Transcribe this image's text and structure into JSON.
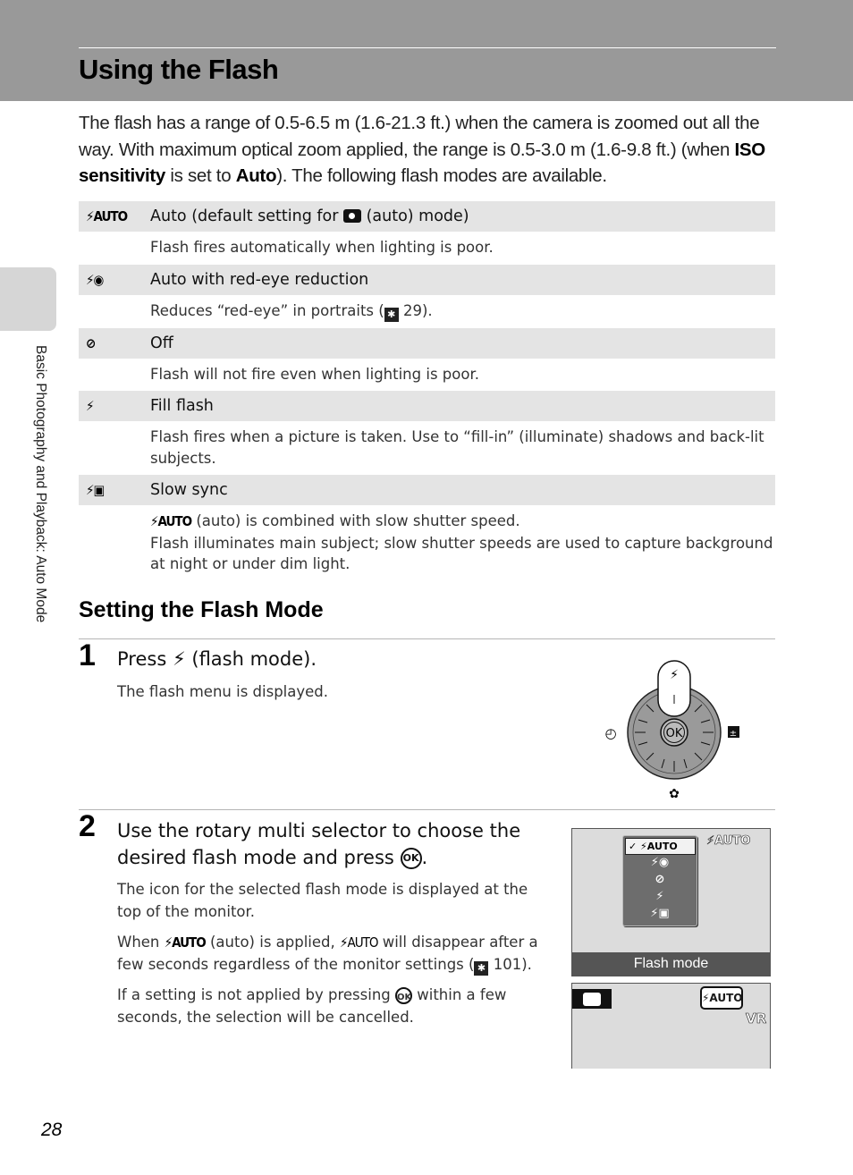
{
  "header": {
    "title": "Using the Flash"
  },
  "intro": {
    "part1": "The flash has a range of 0.5-6.5 m (1.6-21.3 ft.) when the camera is zoomed out all the way. With maximum optical zoom applied, the range is 0.5-3.0 m (1.6-9.8 ft.) (when ",
    "bold1": "ISO sensitivity",
    "part2": " is set to ",
    "bold2": "Auto",
    "part3": "). The following flash modes are available."
  },
  "side_tab": {
    "label": "Basic Photography and Playback: Auto Mode"
  },
  "flash_modes": [
    {
      "icon": "flash-auto-icon",
      "icon_text": "⚡AUTO",
      "title_pre": "Auto (default setting for ",
      "title_post": " (auto) mode)",
      "desc": "Flash fires automatically when lighting is poor."
    },
    {
      "icon": "red-eye-icon",
      "icon_text": "⚡◉",
      "title": "Auto with red-eye reduction",
      "desc_pre": "Reduces “red-eye” in portraits (",
      "desc_ref": "29",
      "desc_post": ")."
    },
    {
      "icon": "flash-off-icon",
      "icon_text": "⊘",
      "title": "Off",
      "desc": "Flash will not fire even when lighting is poor."
    },
    {
      "icon": "fill-flash-icon",
      "icon_text": "⚡",
      "title": "Fill flash",
      "desc": "Flash fires when a picture is taken. Use to “fill-in” (illuminate) shadows and back-lit subjects."
    },
    {
      "icon": "slow-sync-icon",
      "icon_text": "⚡▣",
      "title": "Slow sync",
      "desc_line1_icon": "⚡AUTO",
      "desc_line1": " (auto) is combined with slow shutter speed.",
      "desc_line2": "Flash illuminates main subject; slow shutter speeds are used to capture background at night or under dim light."
    }
  ],
  "section": {
    "title": "Setting the Flash Mode"
  },
  "steps": [
    {
      "number": "1",
      "title_pre": "Press ",
      "title_icon": "⚡",
      "title_post": " (flash mode).",
      "body": "The flash menu is displayed."
    },
    {
      "number": "2",
      "title_line1": "Use the rotary multi selector to choose the",
      "title_line2": "desired flash mode and press ",
      "title_ok": "OK",
      "title_end": ".",
      "p1": "The icon for the selected flash mode is displayed at the top of the monitor.",
      "p2_a": "When ",
      "p2_icon": "⚡AUTO",
      "p2_b": " (auto) is applied, ",
      "p2_icon2": "⚡AUTO",
      "p2_c": " will disappear after a few seconds regardless of the monitor settings (",
      "p2_ref": "101",
      "p2_d": ").",
      "p3_a": "If a setting is not applied by pressing ",
      "p3_ok": "OK",
      "p3_b": " within a few seconds, the selection will be cancelled."
    }
  ],
  "dial": {
    "center": "OK",
    "top": "⚡",
    "left": "◴",
    "right": "±",
    "bottom": "✿"
  },
  "screen1": {
    "selected": "⚡AUTO",
    "items": [
      "⚡◉",
      "⊘",
      "⚡",
      "⚡▣"
    ],
    "indicator": "⚡AUTO",
    "label": "Flash mode"
  },
  "screen2": {
    "mode_indicator": "⚡AUTO",
    "vr": "VR"
  },
  "page_number": "28"
}
